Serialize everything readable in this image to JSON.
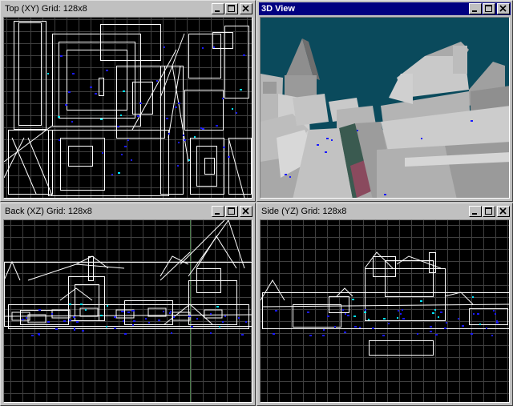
{
  "windows": {
    "top": {
      "title": "Top (XY) Grid: 128x8",
      "active": false
    },
    "view3d": {
      "title": "3D View",
      "active": true
    },
    "back": {
      "title": "Back (XZ) Grid: 128x8",
      "active": false
    },
    "side": {
      "title": "Side (YZ) Grid: 128x8",
      "active": false
    }
  },
  "colors": {
    "wire": "#ffffff",
    "grid": "#3f3f3f",
    "grid_major": "#7a7a7a",
    "sky": "#0a4a5c",
    "entity_blue": "#1a1aff",
    "entity_cyan": "#00e5ff",
    "title_active": "#000080"
  },
  "icons": {
    "minimize": "minimize-icon",
    "maximize": "maximize-icon",
    "close": "close-icon"
  }
}
